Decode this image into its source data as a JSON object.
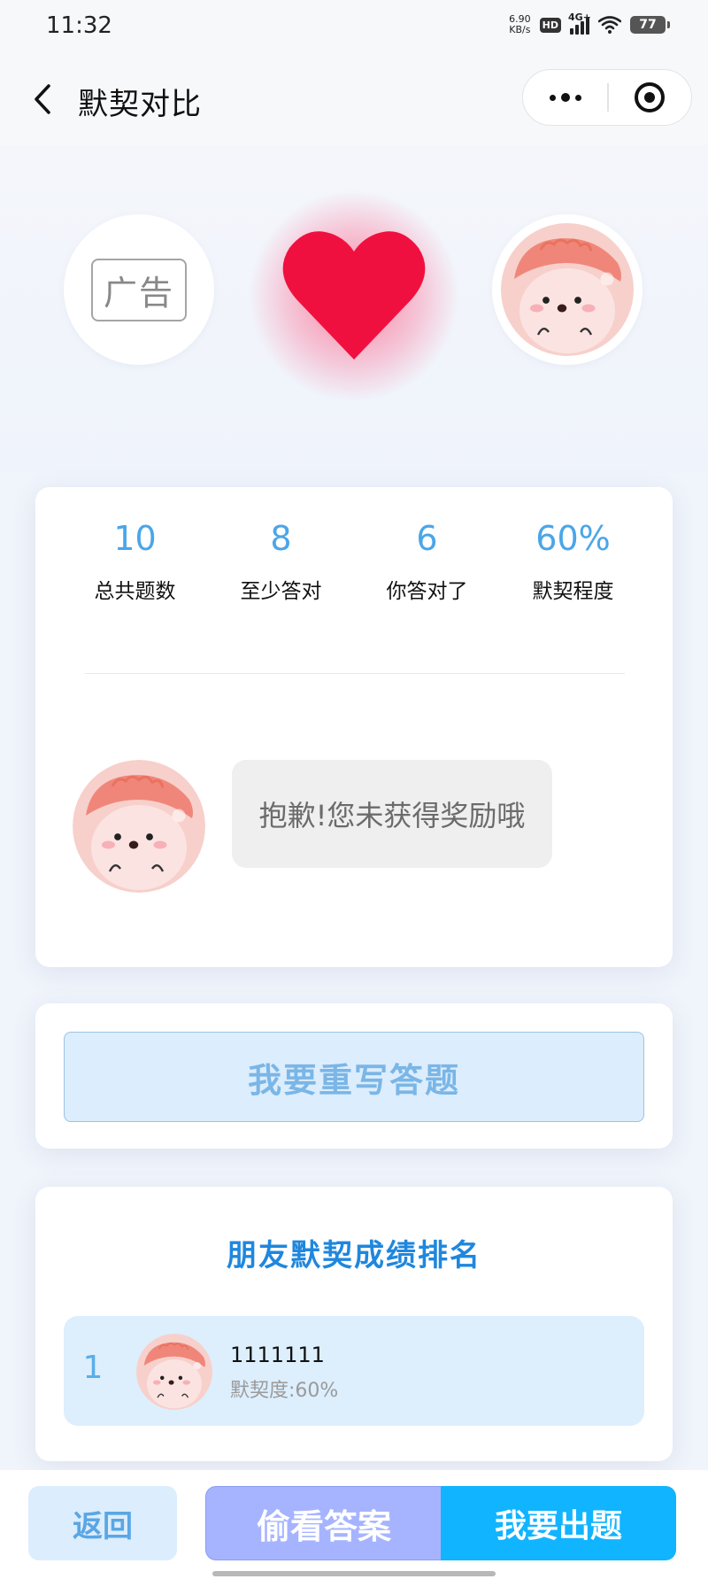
{
  "status_bar": {
    "time": "11:32",
    "net_speed_value": "6.90",
    "net_speed_unit": "KB/s",
    "hd_badge": "HD",
    "network_type": "4G+",
    "battery": "77"
  },
  "nav": {
    "title": "默契对比"
  },
  "hero": {
    "ad_label": "广告",
    "heart_color": "#f0103f"
  },
  "stats": [
    {
      "value": "10",
      "label": "总共题数"
    },
    {
      "value": "8",
      "label": "至少答对"
    },
    {
      "value": "6",
      "label": "你答对了"
    },
    {
      "value": "60%",
      "label": "默契程度"
    }
  ],
  "result": {
    "message": "抱歉!您未获得奖励哦"
  },
  "rewrite": {
    "button_label": "我要重写答题"
  },
  "ranking": {
    "title": "朋友默契成绩排名",
    "items": [
      {
        "rank": "1",
        "name": "1111111",
        "score": "默契度:60%"
      }
    ]
  },
  "bottom_bar": {
    "back_label": "返回",
    "peek_label": "偷看答案",
    "create_label": "我要出题"
  },
  "colors": {
    "accent": "#11b4ff",
    "stat_value": "#4aa6e8",
    "ranking_title": "#1f87dd",
    "peek": "#a6b4ff"
  }
}
